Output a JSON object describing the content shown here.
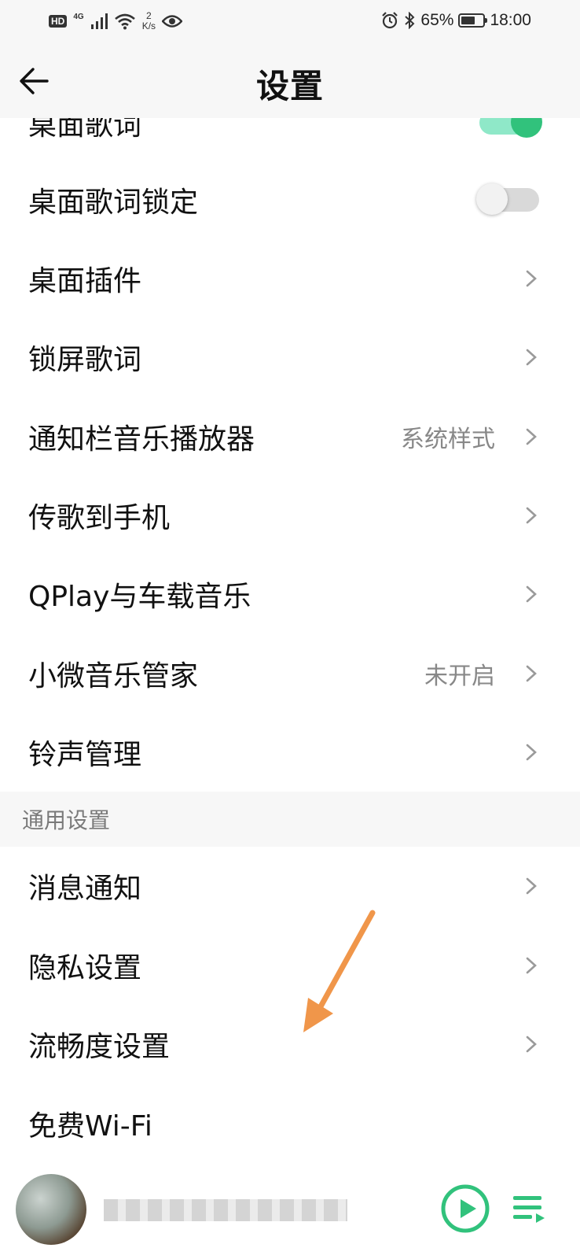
{
  "status_bar": {
    "hd": "HD",
    "network": "4G",
    "speed_value": "2",
    "speed_unit": "K/s",
    "battery_percent": "65%",
    "battery_level": 0.65,
    "time": "18:00"
  },
  "header": {
    "back_icon": "arrow-left-icon",
    "title": "设置"
  },
  "rows_top": [
    {
      "label": "桌面歌词",
      "control": "toggle",
      "toggle_on": true
    },
    {
      "label": "桌面歌词锁定",
      "control": "toggle",
      "toggle_on": false
    },
    {
      "label": "桌面插件",
      "control": "chevron"
    },
    {
      "label": "锁屏歌词",
      "control": "chevron"
    },
    {
      "label": "通知栏音乐播放器",
      "value": "系统样式",
      "control": "chevron"
    },
    {
      "label": "传歌到手机",
      "control": "chevron"
    },
    {
      "label": "QPlay与车载音乐",
      "control": "chevron"
    },
    {
      "label": "小微音乐管家",
      "value": "未开启",
      "control": "chevron"
    },
    {
      "label": "铃声管理",
      "control": "chevron"
    }
  ],
  "section": {
    "title": "通用设置"
  },
  "rows_general": [
    {
      "label": "消息通知",
      "control": "chevron"
    },
    {
      "label": "隐私设置",
      "control": "chevron"
    },
    {
      "label": "流畅度设置",
      "control": "chevron"
    },
    {
      "label": "免费Wi-Fi",
      "control": "chevron"
    }
  ],
  "colors": {
    "accent": "#31c27c",
    "toggle_track_on": "#8fe8c8",
    "annotation_arrow": "#f0964a",
    "section_bg": "#f7f7f7"
  },
  "mini_player": {
    "play_icon": "play-circle-icon",
    "playlist_icon": "playlist-icon"
  }
}
